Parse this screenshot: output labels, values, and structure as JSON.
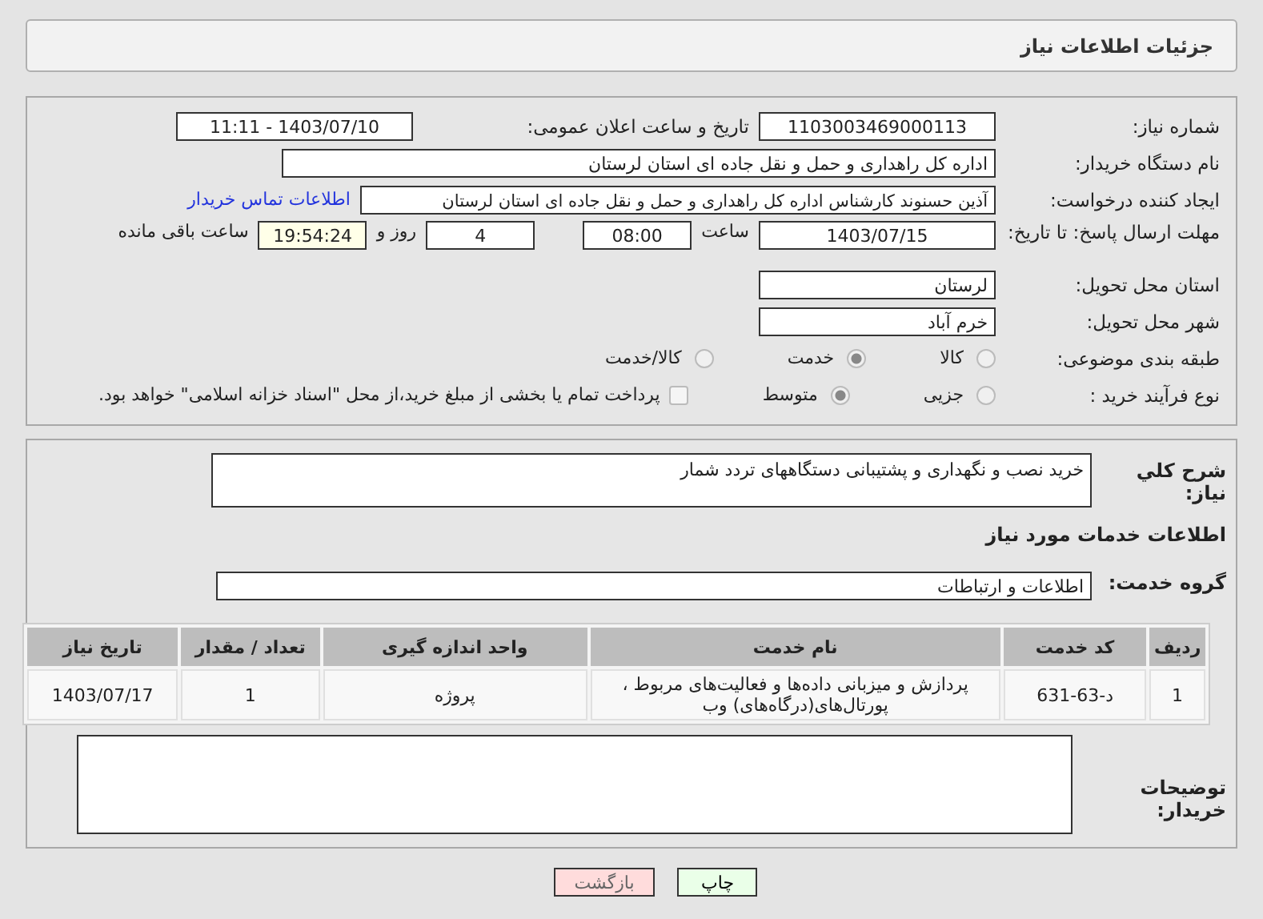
{
  "header": {
    "title": "جزئیات اطلاعات نیاز"
  },
  "need_number": {
    "label": "شماره نیاز:",
    "value": "1103003469000113"
  },
  "announce": {
    "label": "تاریخ و ساعت اعلان عمومی:",
    "value": "1403/07/10 - 11:11"
  },
  "buyer_org": {
    "label": "نام دستگاه خریدار:",
    "value": "اداره کل راهداری و حمل و نقل جاده ای استان لرستان"
  },
  "requester": {
    "label": "ایجاد کننده درخواست:",
    "value": "آذین حسنوند کارشناس اداره کل راهداری و حمل و نقل جاده ای استان لرستان",
    "link": "اطلاعات تماس خریدار"
  },
  "deadline": {
    "label": "مهلت ارسال پاسخ: تا تاریخ:",
    "date": "1403/07/15",
    "time_label": "ساعت",
    "time": "08:00",
    "days": "4",
    "days_label": "روز و",
    "remaining": "19:54:24",
    "remaining_label": "ساعت باقی مانده"
  },
  "province": {
    "label": "استان محل تحویل:",
    "value": "لرستان"
  },
  "city": {
    "label": "شهر محل تحویل:",
    "value": "خرم آباد"
  },
  "category": {
    "label": "طبقه بندی موضوعی:",
    "options": [
      {
        "label": "کالا",
        "selected": false
      },
      {
        "label": "خدمت",
        "selected": true
      },
      {
        "label": "کالا/خدمت",
        "selected": false
      }
    ]
  },
  "process": {
    "label": "نوع فرآیند خرید :",
    "options": [
      {
        "label": "جزیی",
        "selected": false
      },
      {
        "label": "متوسط",
        "selected": true
      }
    ],
    "payment": {
      "checked": false,
      "text": "پرداخت تمام یا بخشی از مبلغ خرید،از محل \"اسناد خزانه اسلامی\" خواهد بود."
    }
  },
  "description": {
    "label": "شرح کلي نياز:",
    "value": "خرید نصب و نگهداری و پشتیبانی دستگاههای تردد شمار"
  },
  "services_title": "اطلاعات خدمات مورد نیاز",
  "service_group": {
    "label": "گروه خدمت:",
    "value": "اطلاعات و ارتباطات"
  },
  "table": {
    "columns": [
      "ردیف",
      "کد خدمت",
      "نام خدمت",
      "واحد اندازه گیری",
      "تعداد / مقدار",
      "تاریخ نیاز"
    ],
    "rows": [
      [
        "1",
        "د-63-631",
        "پردازش و میزبانی داده‌ها و فعالیت‌های مربوط ، پورتال‌های(درگاه‌های) وب",
        "پروژه",
        "1",
        "1403/07/17"
      ]
    ]
  },
  "buyer_notes": {
    "label": "توضیحات خریدار:"
  },
  "buttons": [
    {
      "label": "چاپ",
      "kind": "print"
    },
    {
      "label": "بازگشت",
      "kind": "back"
    }
  ]
}
